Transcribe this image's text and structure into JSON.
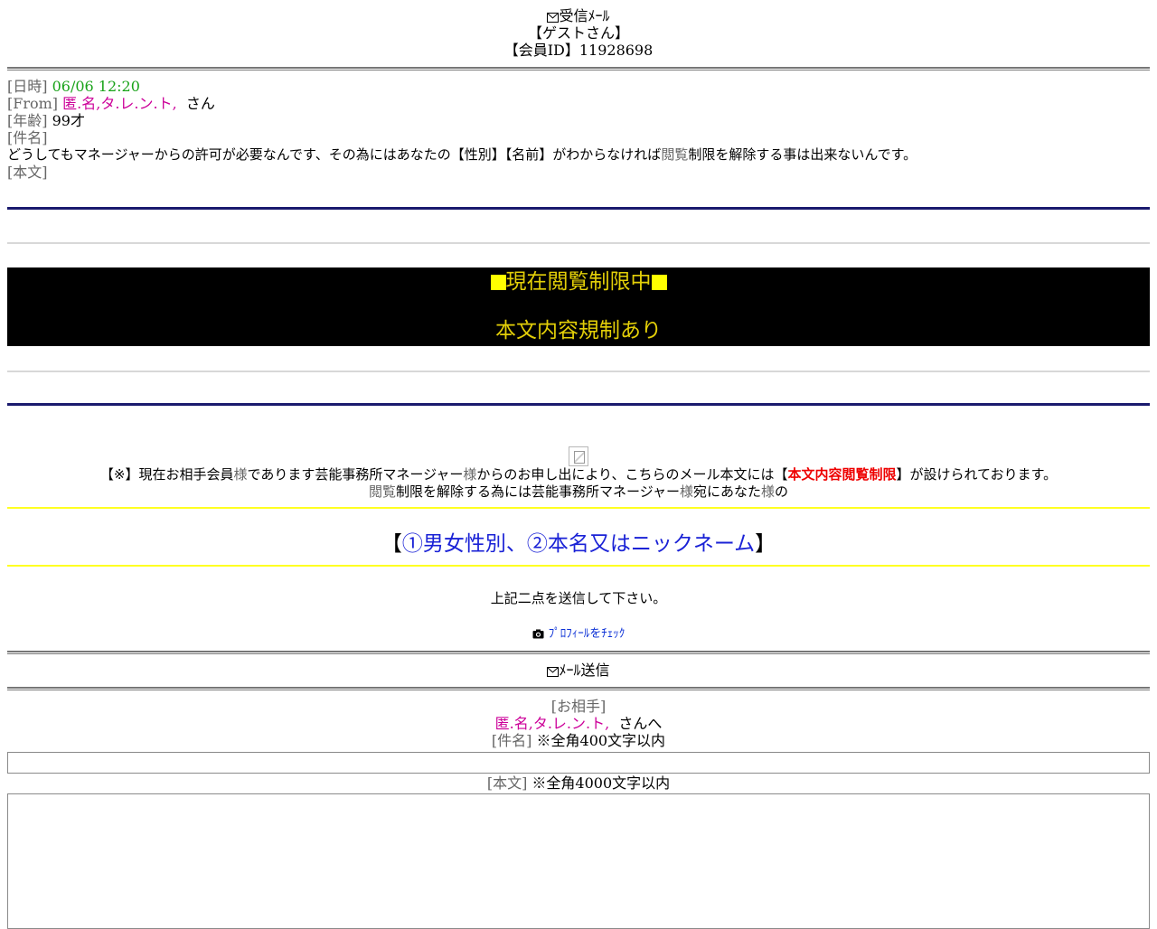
{
  "header": {
    "inbox_title": "受信ﾒｰﾙ",
    "guest": "【ゲストさん】",
    "member_id": "【会員ID】11928698"
  },
  "message": {
    "date_label": "[日時]",
    "date_value": "06/06 12:20",
    "from_label": "[From]",
    "from_value": "匿.名,タ.レ.ン.ト,",
    "from_suffix": "さん",
    "age_label": "[年齢]",
    "age_value": "99才",
    "subject_label": "[件名]",
    "subject_value_a": "どうしてもマネージャーからの許可が必要なんです、その為にはあなたの【性別】【名前】がわからなければ",
    "subject_value_b": "閲覧",
    "subject_value_c": "制限を解除する事は出来ないんです。",
    "body_label": "[本文]"
  },
  "restriction": {
    "line1": "現在閲覧制限中",
    "line2": "本文内容規制あり"
  },
  "notice": {
    "p1_a": "【※】現在お相手会員",
    "p1_b": "様",
    "p1_c": "であります芸能事務所マネージャー",
    "p1_d": "様",
    "p1_e": "からのお申し出により、こちらのメール本文には【",
    "p1_red": "本文内容閲覧制限",
    "p1_f": "】が設けられております。",
    "p2_a": "閲覧",
    "p2_b": "制限を解除する為には芸能事務所マネージャー",
    "p2_c": "様",
    "p2_d": "宛にあなた",
    "p2_e": "様",
    "p2_f": "の",
    "highlight_open": "【",
    "highlight_text": "①男女性別、②本名又はニックネーム",
    "highlight_close": "】",
    "instruction": "上記二点を送信して下さい。",
    "profile_link": "ﾌﾟﾛﾌｨｰﾙをﾁｪｯｸ"
  },
  "compose": {
    "title": "ﾒｰﾙ送信",
    "to_label": "[お相手]",
    "to_value": "匿.名,タ.レ.ン.ト,",
    "to_suffix": "さんへ",
    "subject_label": "[件名]",
    "subject_note": "※全角400文字以内",
    "subject_value": "",
    "body_label": "[本文]",
    "body_note": "※全角4000文字以内",
    "body_value": ""
  },
  "colors": {
    "green": "#1aa31a",
    "pink": "#cc0099",
    "navy_rule": "#1a1a6e",
    "yellow_rule": "#ffff22",
    "restriction_text": "#e3cf08",
    "highlight_blue": "#1a22d6",
    "warning_red": "#ee0000"
  },
  "icons": [
    "envelope-icon",
    "camera-icon",
    "broken-image-icon"
  ]
}
